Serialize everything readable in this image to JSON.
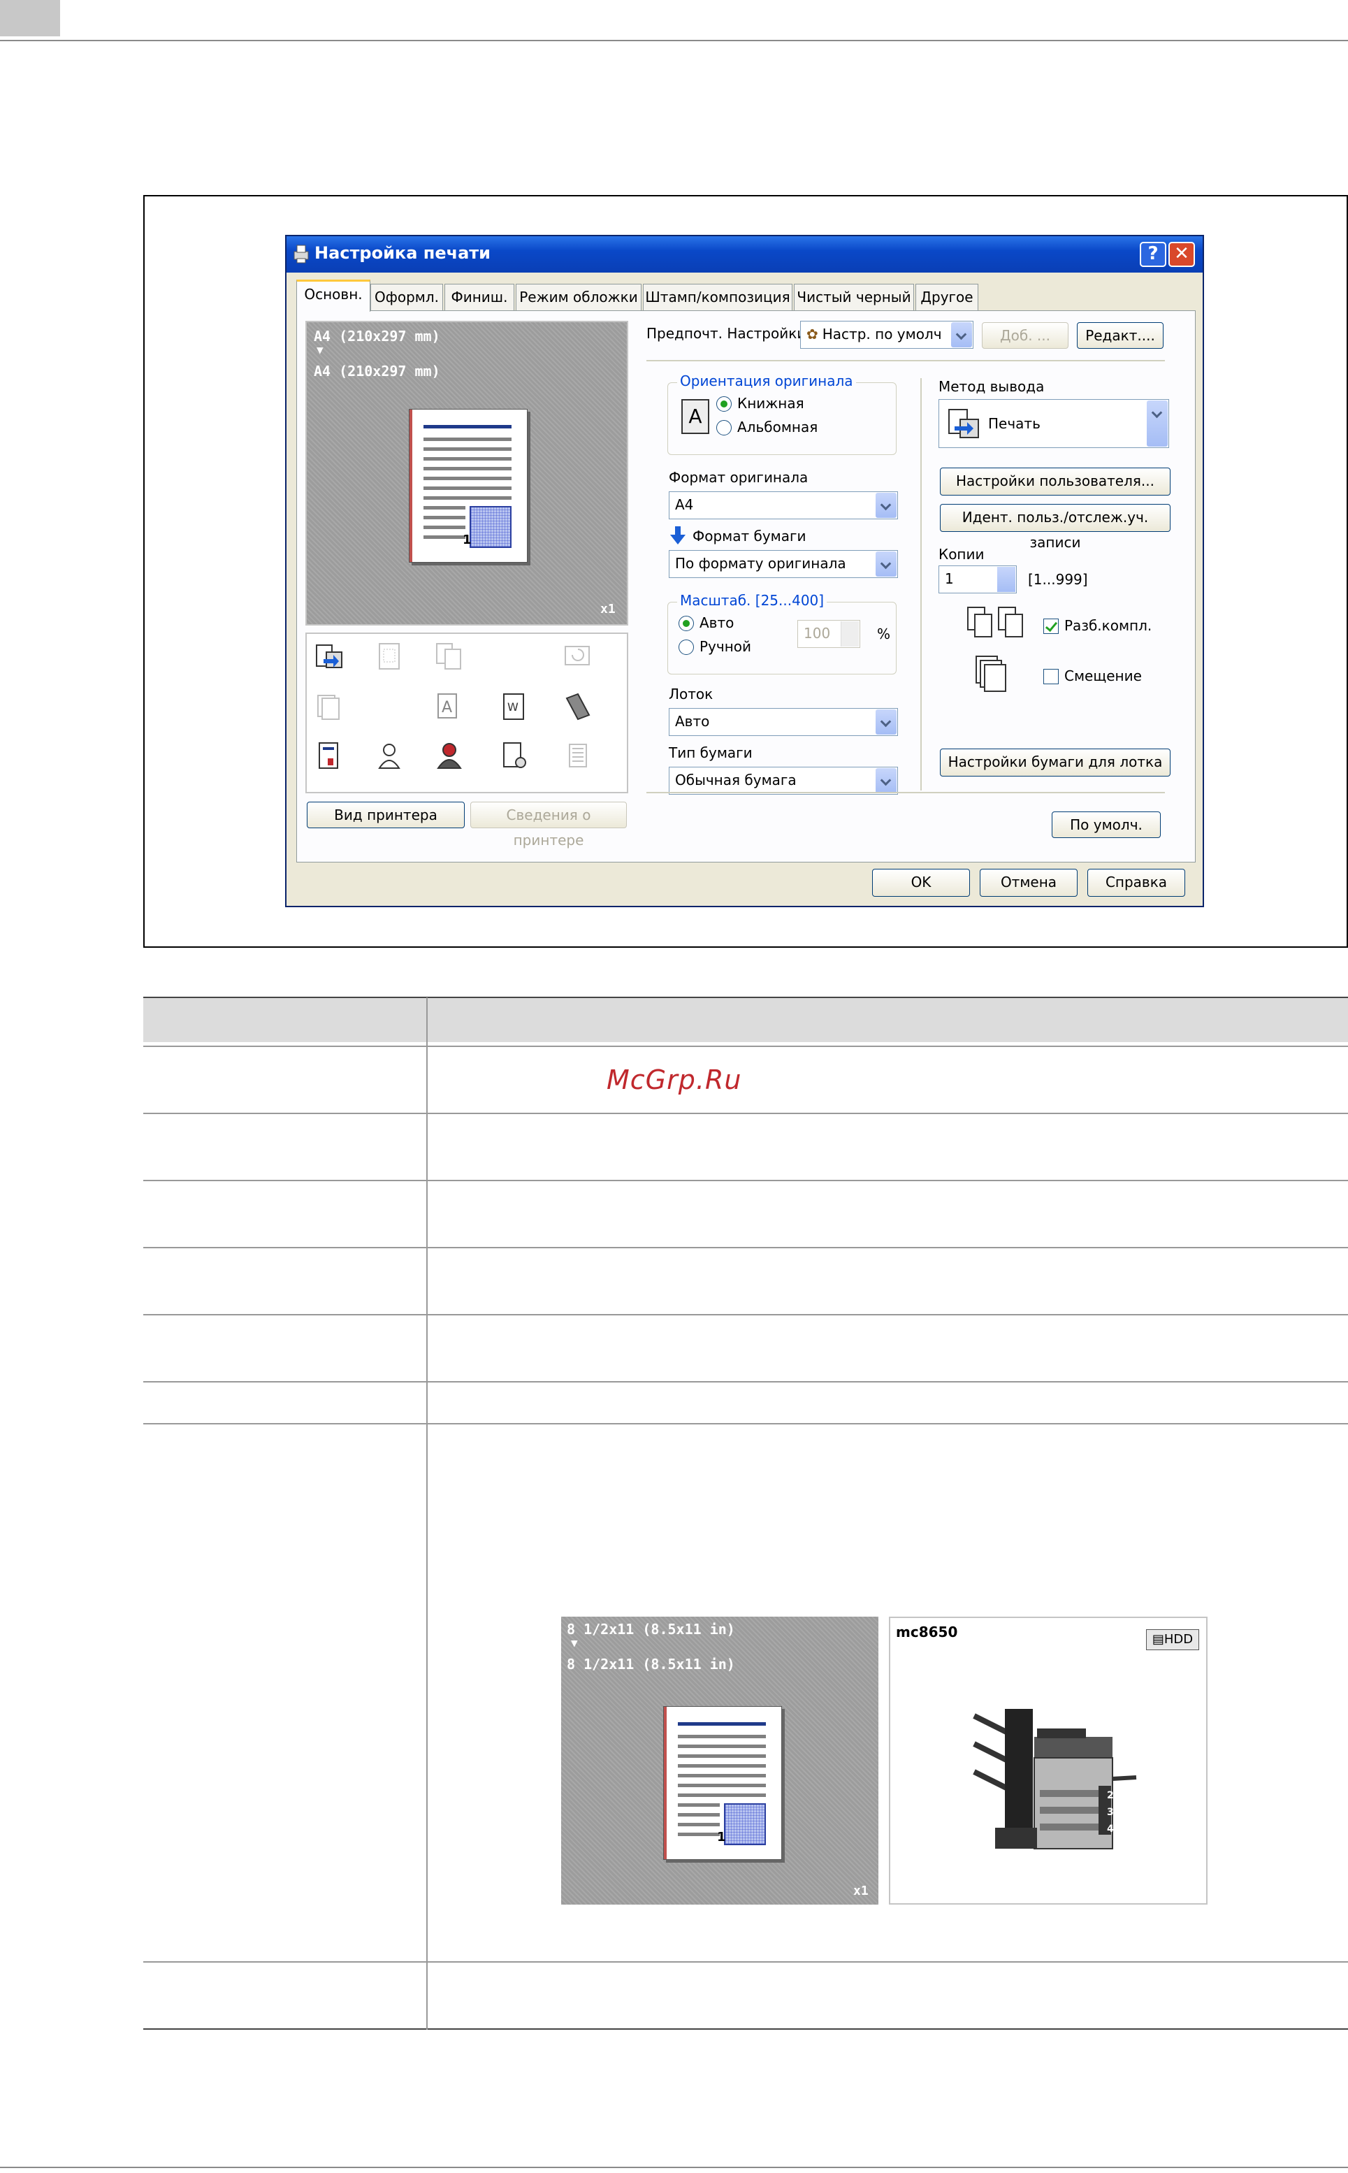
{
  "dialog": {
    "title": "Настройка печати",
    "tabs": [
      "Основн.",
      "Оформл.",
      "Финиш.",
      "Режим обложки",
      "Штамп/композиция",
      "Чистый черный",
      "Другое"
    ],
    "preview": {
      "original_size": "A4 (210x297 mm)",
      "arrow": "▼",
      "paper_size": "A4 (210x297 mm)",
      "copies_badge": "x1",
      "page_number": "1"
    },
    "printer_view_button": "Вид принтера",
    "printer_info_button": "Сведения о принтере",
    "favorites": {
      "label": "Предпочт. Настройки",
      "value": "Настр. по умолч",
      "add_button": "Доб. ...",
      "edit_button": "Редакт...."
    },
    "orientation": {
      "title": "Ориентация оригинала",
      "portrait": "Книжная",
      "landscape": "Альбомная",
      "icon_letter": "A"
    },
    "original_format": {
      "label": "Формат оригинала",
      "value": "A4"
    },
    "paper_format": {
      "label": "Формат бумаги",
      "value": "По формату оригинала"
    },
    "zoom": {
      "title": "Масштаб.  [25...400]",
      "auto": "Авто",
      "manual": "Ручной",
      "value": "100",
      "unit": "%"
    },
    "tray": {
      "label": "Лоток",
      "value": "Авто"
    },
    "paper_type": {
      "label": "Тип бумаги",
      "value": "Обычная бумага"
    },
    "output_method": {
      "label": "Метод вывода",
      "value": "Печать"
    },
    "user_settings_button": "Настройки пользователя...",
    "user_id_button": "Идент. польз./отслеж.уч. записи",
    "copies": {
      "label": "Копии",
      "value": "1",
      "range": "[1...999]"
    },
    "collate": "Разб.компл.",
    "offset": "Смещение",
    "tray_paper_button": "Настройки бумаги для лотка",
    "defaults_button": "По умолч.",
    "ok": "OK",
    "cancel": "Отмена",
    "help": "Справка",
    "help_glyph": "?",
    "close_glyph": "✕"
  },
  "watermark": "McGrp.Ru",
  "second_preview": {
    "original_size": "8 1/2x11 (8.5x11 in)",
    "arrow": "▼",
    "paper_size": "8 1/2x11 (8.5x11 in)",
    "copies_badge": "x1",
    "page_number": "1"
  },
  "printer_view": {
    "model": "mc8650",
    "hdd_badge": "HDD",
    "tray_numbers": [
      "2",
      "3",
      "4"
    ]
  },
  "colors": {
    "titlebar": "#0a48c8",
    "dialog_bg": "#ece9d8",
    "group_title": "#0046d5",
    "watermark": "#c0282d"
  }
}
